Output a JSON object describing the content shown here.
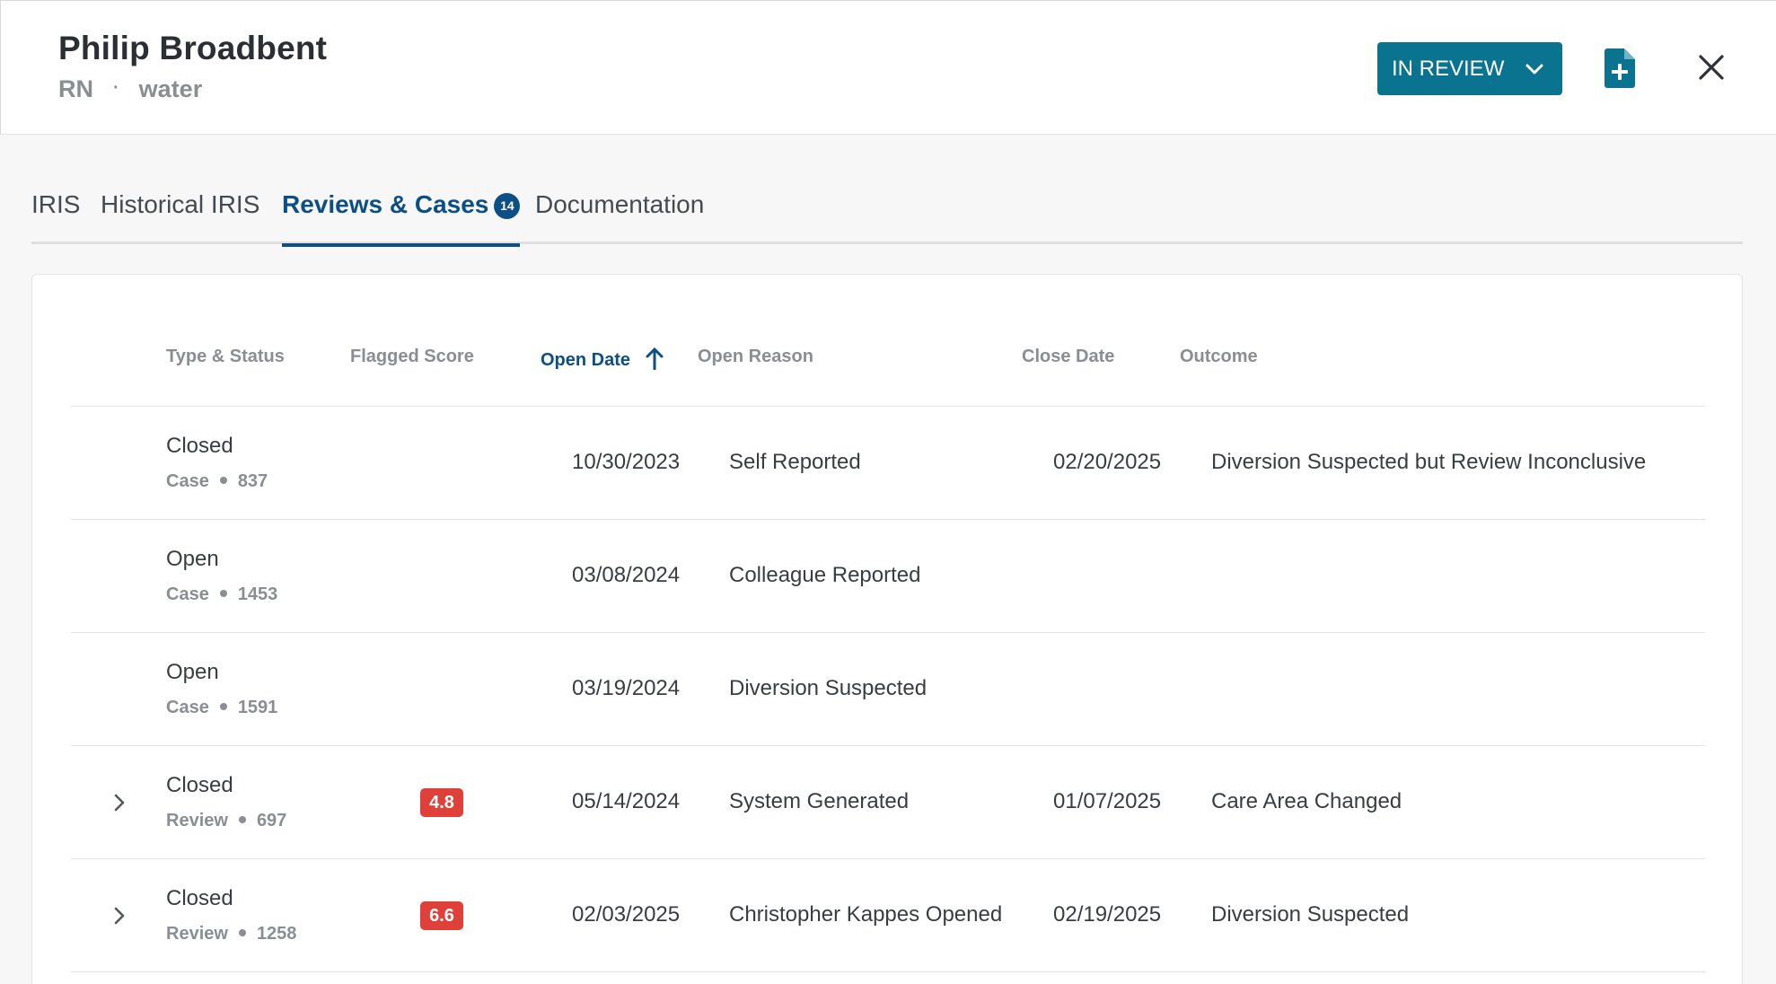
{
  "header": {
    "name": "Philip Broadbent",
    "role": "RN",
    "separator": "·",
    "unit": "water",
    "status_label": "IN REVIEW",
    "icons": {
      "status_chevron": "chevron-down-icon",
      "add_document": "document-add-icon",
      "close": "close-icon"
    }
  },
  "tabs": [
    {
      "label": "IRIS",
      "active": false
    },
    {
      "label": "Historical IRIS",
      "active": false
    },
    {
      "label": "Reviews & Cases",
      "active": true,
      "badge": "14"
    },
    {
      "label": "Documentation",
      "active": false
    }
  ],
  "table": {
    "columns": {
      "type_status": "Type & Status",
      "flagged_score": "Flagged Score",
      "open_date": "Open Date",
      "open_reason": "Open Reason",
      "close_date": "Close Date",
      "outcome": "Outcome"
    },
    "sort": {
      "column": "open_date",
      "direction": "ascending",
      "icon": "arrow-up-icon"
    },
    "rows": [
      {
        "status": "Closed",
        "type": "Case",
        "id": "837",
        "score": "",
        "open_date": "10/30/2023",
        "open_reason": "Self Reported",
        "close_date": "02/20/2025",
        "outcome": "Diversion Suspected but Review Inconclusive",
        "expandable": false
      },
      {
        "status": "Open",
        "type": "Case",
        "id": "1453",
        "score": "",
        "open_date": "03/08/2024",
        "open_reason": "Colleague Reported",
        "close_date": "",
        "outcome": "",
        "expandable": false
      },
      {
        "status": "Open",
        "type": "Case",
        "id": "1591",
        "score": "",
        "open_date": "03/19/2024",
        "open_reason": "Diversion Suspected",
        "close_date": "",
        "outcome": "",
        "expandable": false
      },
      {
        "status": "Closed",
        "type": "Review",
        "id": "697",
        "score": "4.8",
        "open_date": "05/14/2024",
        "open_reason": "System Generated",
        "close_date": "01/07/2025",
        "outcome": "Care Area Changed",
        "expandable": true
      },
      {
        "status": "Closed",
        "type": "Review",
        "id": "1258",
        "score": "6.6",
        "open_date": "02/03/2025",
        "open_reason": "Christopher Kappes Opened",
        "close_date": "02/19/2025",
        "outcome": "Diversion Suspected",
        "expandable": true
      }
    ]
  },
  "colors": {
    "primary": "#0a7490",
    "accent_blue": "#0b4f86",
    "score_red": "#e0403a"
  }
}
